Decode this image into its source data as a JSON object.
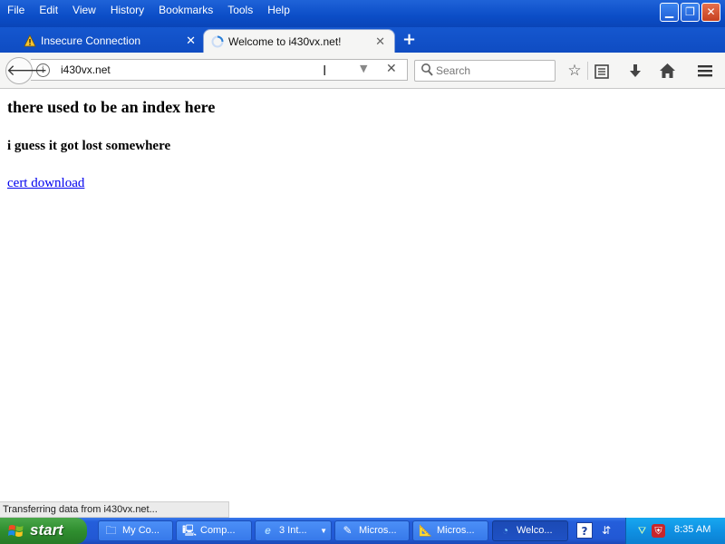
{
  "menu": {
    "items": [
      "File",
      "Edit",
      "View",
      "History",
      "Bookmarks",
      "Tools",
      "Help"
    ]
  },
  "window_controls": [
    "minimize-icon",
    "restore-icon",
    "close-icon"
  ],
  "tabs": [
    {
      "label": "Insecure Connection",
      "icon": "warning-icon",
      "active": false
    },
    {
      "label": "Welcome to i430vx.net!",
      "icon": "loading-spinner-icon",
      "active": true
    }
  ],
  "navbar": {
    "url": "i430vx.net",
    "search_placeholder": "Search"
  },
  "page": {
    "heading": "there used to be an index here",
    "subheading": "i guess it got lost somewhere",
    "link": "cert download"
  },
  "status": {
    "text": "Transferring data from i430vx.net..."
  },
  "taskbar": {
    "start_label": "start",
    "tasks": [
      {
        "label": "My Co...",
        "icon": "folder-icon"
      },
      {
        "label": "Comp...",
        "icon": "computer-icon"
      },
      {
        "label": "3 Int...",
        "icon": "internet-explorer-icon"
      },
      {
        "label": "Micros...",
        "icon": "pen-icon"
      },
      {
        "label": "Micros...",
        "icon": "ruler-icon"
      },
      {
        "label": "Welco...",
        "icon": "firefox-icon"
      }
    ],
    "clock": "8:35 AM"
  },
  "colors": {
    "xp_blue": "#245edb",
    "start_green": "#2f8e2f",
    "tray_blue": "#0f91e3",
    "link": "#0000ee"
  }
}
